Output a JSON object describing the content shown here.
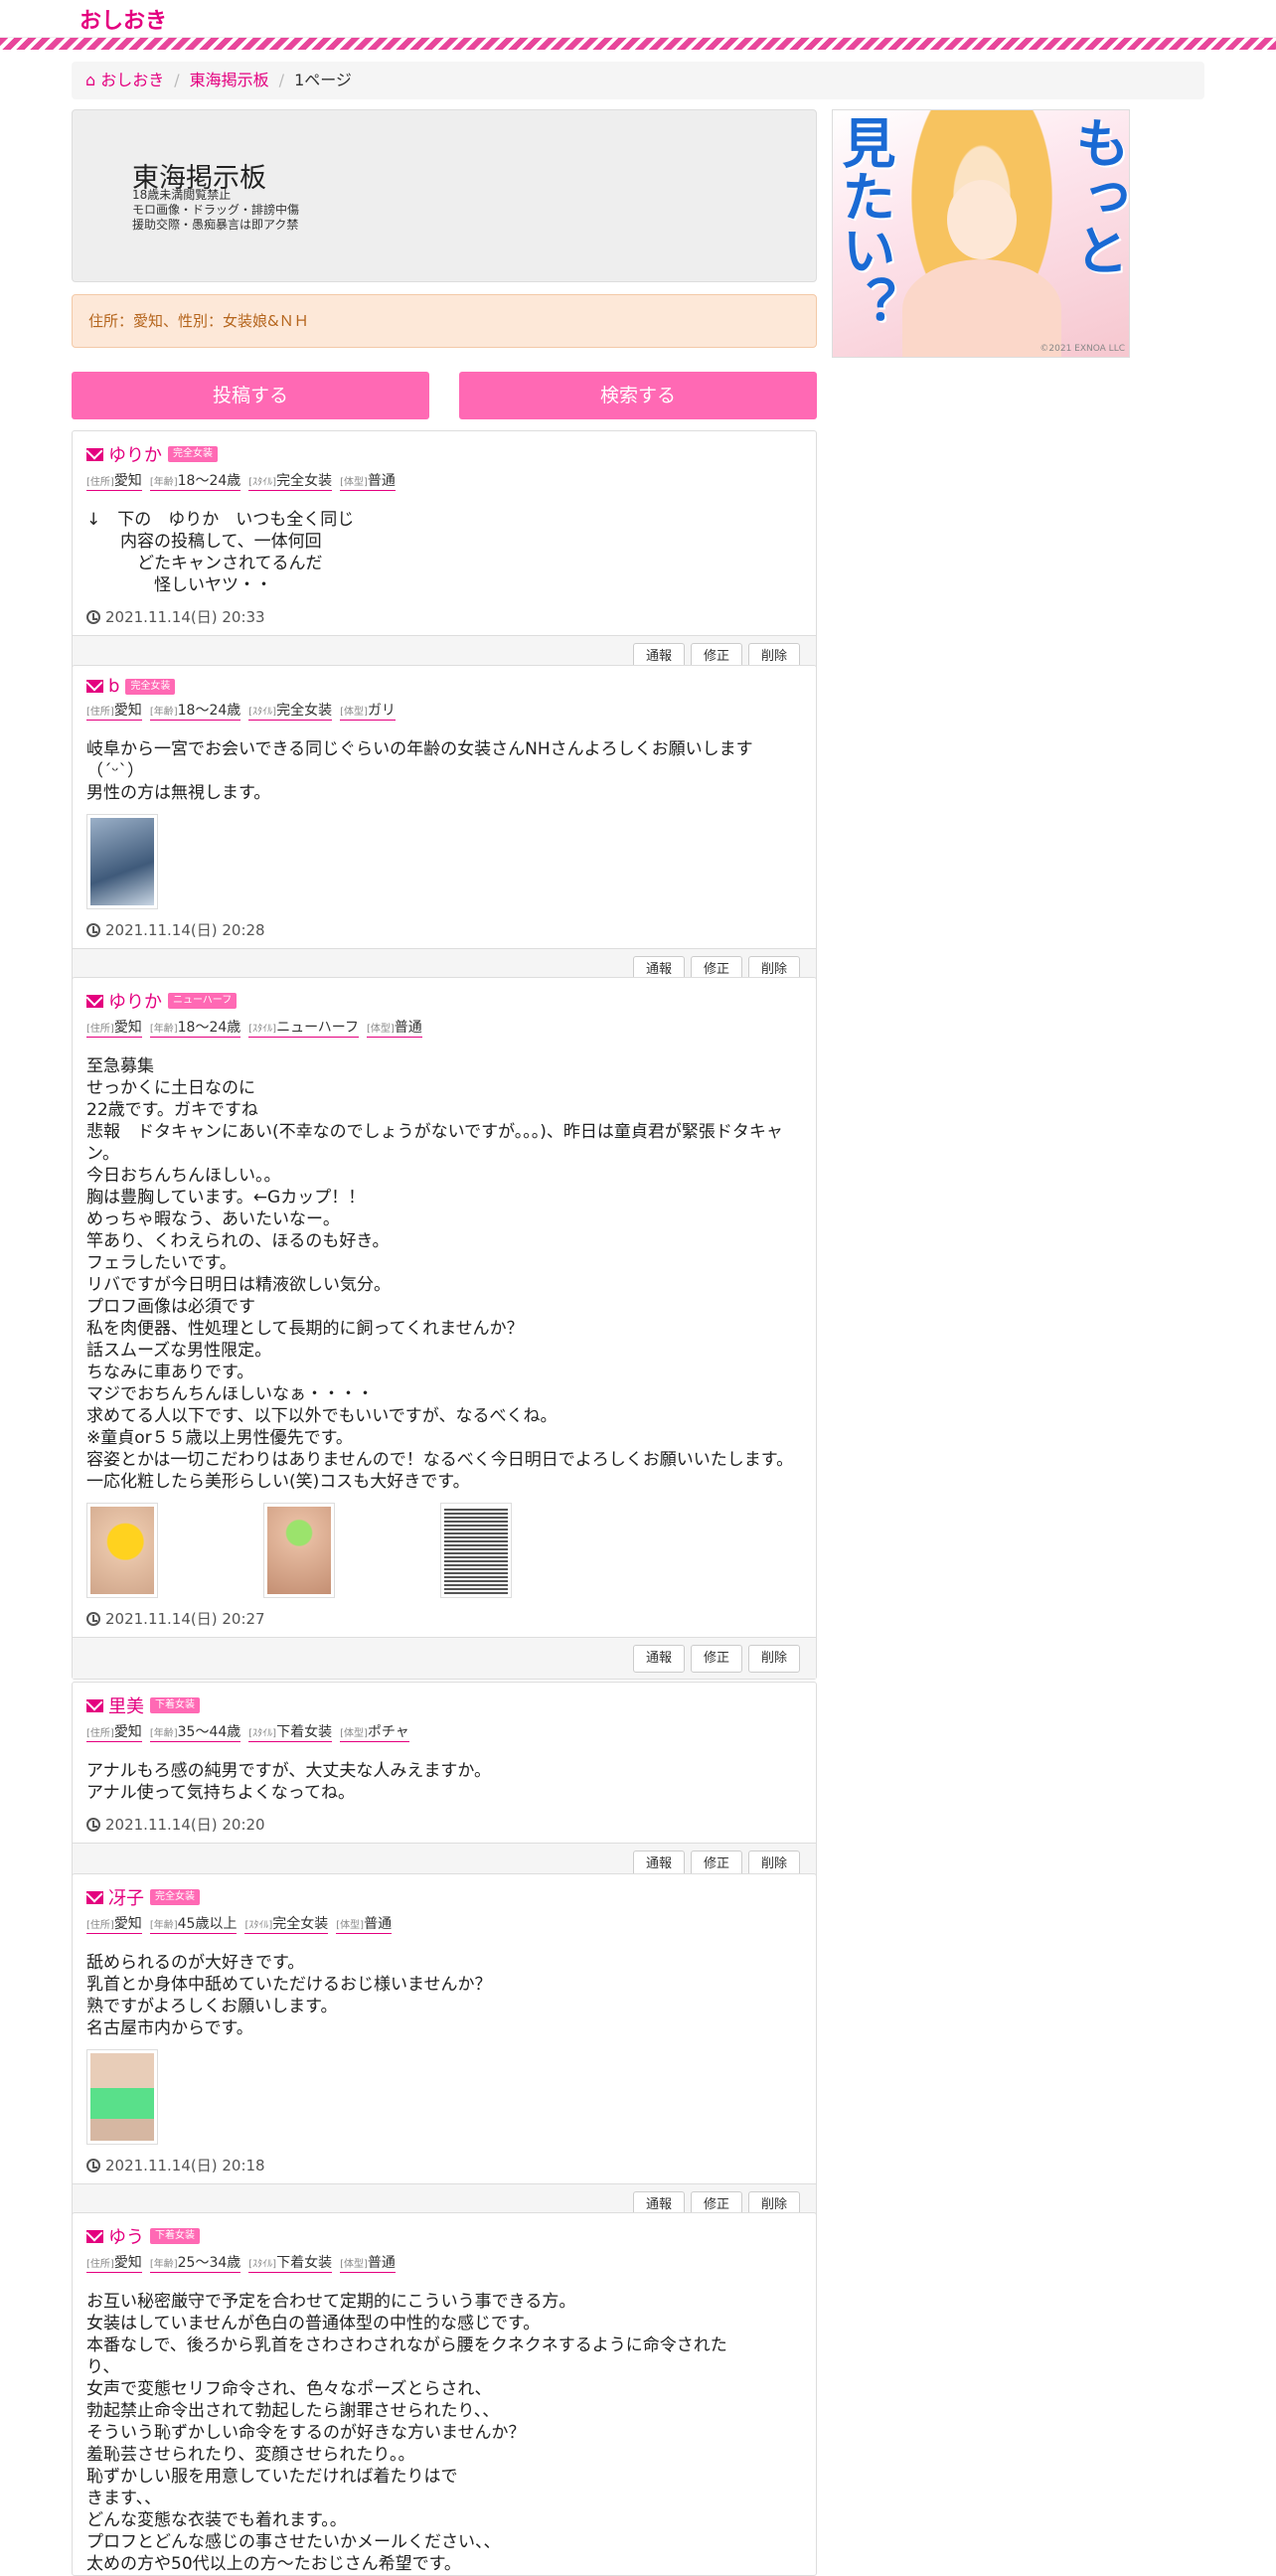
{
  "site": {
    "logo": "おしおき"
  },
  "breadcrumb": {
    "home": "おしおき",
    "board": "東海掲示板",
    "page": "1ページ"
  },
  "board": {
    "title": "東海掲示板",
    "notes": [
      "18歳未満閲覧禁止",
      "モロ画像・ドラッグ・誹謗中傷",
      "援助交際・愚痴暴言は即アク禁"
    ]
  },
  "filter": {
    "text": "住所：愛知、性別：女装娘&ＮＨ"
  },
  "actions": {
    "post": "投稿する",
    "search": "検索する"
  },
  "ad": {
    "line1": "もっと",
    "line2": "見たい？",
    "copy": "©2021 EXNOA LLC"
  },
  "labels": {
    "addr": "[住所]",
    "age": "[年齢]",
    "style": "[ｽﾀｲﾙ]",
    "body": "[体型]",
    "report": "通報",
    "edit": "修正",
    "delete": "削除"
  },
  "posts": [
    {
      "name": "ゆりか",
      "badge": "完全女装",
      "addr": "愛知",
      "age": "18〜24歳",
      "style": "完全女装",
      "body": "普通",
      "text": "↓　下の　ゆりか　いつも全く同じ\n　　内容の投稿して、一体何回\n　　　どたキャンされてるんだ\n　　　　怪しいヤツ・・",
      "time": "2021.11.14(日) 20:33"
    },
    {
      "name": "b",
      "badge": "完全女装",
      "addr": "愛知",
      "age": "18〜24歳",
      "style": "完全女装",
      "body": "ガリ",
      "text": "岐阜から一宮でお会いできる同じぐらいの年齢の女装さんNHさんよろしくお願いします（ˊᵕˋ）\n男性の方は無視します。",
      "time": "2021.11.14(日) 20:28"
    },
    {
      "name": "ゆりか",
      "badge": "ニューハーフ",
      "addr": "愛知",
      "age": "18〜24歳",
      "style": "ニューハーフ",
      "body": "普通",
      "text": "至急募集\nせっかくに土日なのに\n22歳です。ガキですね\n悲報　ドタキャンにあい(不幸なのでしょうがないですが。。。)、昨日は童貞君が緊張ドタキャン。\n今日おちんちんほしい。。\n胸は豊胸しています。←Gカップ！！\nめっちゃ暇なう、あいたいなー。\n竿あり、くわえられの、ほるのも好き。\nフェラしたいです。\nリバですが今日明日は精液欲しい気分。\nプロフ画像は必須です\n私を肉便器、性処理として長期的に飼ってくれませんか？\n話スムーズな男性限定。\nちなみに車ありです。\nマジでおちんちんほしいなぁ・・・・\n求めてる人以下です、以下以外でもいいですが、なるべくね。\n※童貞or５５歳以上男性優先です。\n容姿とかは一切こだわりはありませんので！なるべく今日明日でよろしくお願いいたします。\n一応化粧したら美形らしい(笑)コスも大好きです。",
      "time": "2021.11.14(日) 20:27"
    },
    {
      "name": "里美",
      "badge": "下着女装",
      "addr": "愛知",
      "age": "35〜44歳",
      "style": "下着女装",
      "body": "ポチャ",
      "text": "アナルもろ感の純男ですが、大丈夫な人みえますか。\nアナル使って気持ちよくなってね。",
      "time": "2021.11.14(日) 20:20"
    },
    {
      "name": "冴子",
      "badge": "完全女装",
      "addr": "愛知",
      "age": "45歳以上",
      "style": "完全女装",
      "body": "普通",
      "text": "舐められるのが大好きです。\n乳首とか身体中舐めていただけるおじ様いませんか？\n熟ですがよろしくお願いします。\n名古屋市内からです。",
      "time": "2021.11.14(日) 20:18"
    },
    {
      "name": "ゆう",
      "badge": "下着女装",
      "addr": "愛知",
      "age": "25〜34歳",
      "style": "下着女装",
      "body": "普通",
      "text": "お互い秘密厳守で予定を合わせて定期的にこういう事できる方。\n女装はしていませんが色白の普通体型の中性的な感じです。\n本番なしで、後ろから乳首をさわさわされながら腰をクネクネするように命令された\nり、\n女声で変態セリフ命令され、色々なポーズとらされ、\n勃起禁止命令出されて勃起したら謝罪させられたり、、\nそういう恥ずかしい命令をするのが好きな方いませんか？\n羞恥芸させられたり、変顔させられたり。。\n恥ずかしい服を用意していただければ着たりはで\nきます、、\nどんな変態な衣装でも着れます。。\nプロフとどんな感じの事させたいかメールください、、\n太めの方や50代以上の方～たおじさん希望です。",
      "time": ""
    }
  ]
}
